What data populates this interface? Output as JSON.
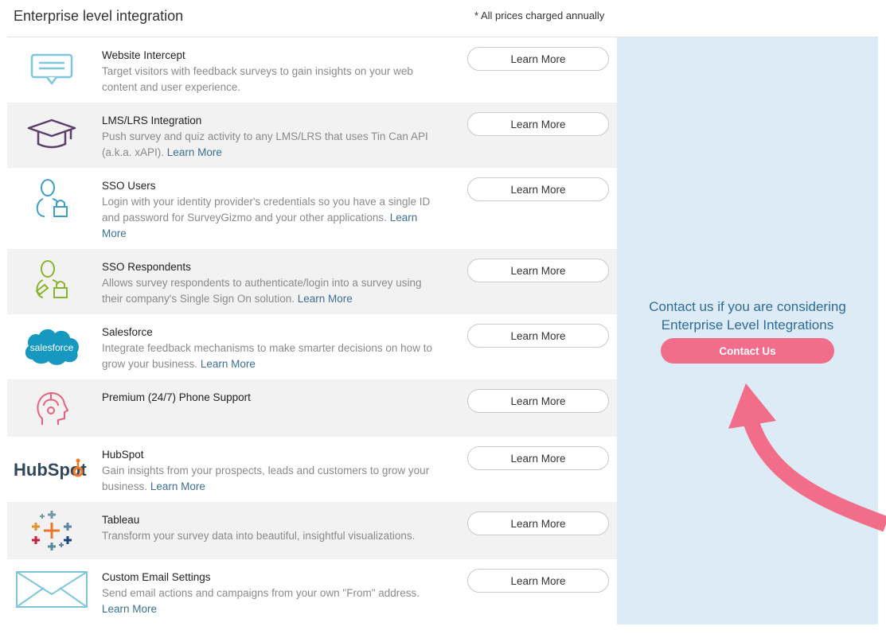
{
  "header": {
    "title": "Enterprise level integration",
    "note": "* All prices charged annually"
  },
  "integrations": [
    {
      "title": "Website Intercept",
      "desc": "Target visitors with feedback surveys to gain insights on your web content and user experience.",
      "link": "",
      "button": "Learn More",
      "icon": "chat-bubble-icon"
    },
    {
      "title": "LMS/LRS Integration",
      "desc": "Push survey and quiz activity to any LMS/LRS that uses Tin Can API (a.k.a. xAPI).",
      "link": "Learn More",
      "button": "Learn More",
      "icon": "graduation-cap-icon"
    },
    {
      "title": "SSO Users",
      "desc": "Login with your identity provider's credentials so you have a single ID and password for SurveyGizmo and your other applications.",
      "link": "Learn More",
      "button": "Learn More",
      "icon": "user-lock-icon"
    },
    {
      "title": "SSO Respondents",
      "desc": "Allows survey respondents to authenticate/login into a survey using their company's Single Sign On solution.",
      "link": "Learn More",
      "button": "Learn More",
      "icon": "respondent-lock-icon"
    },
    {
      "title": "Salesforce",
      "desc": "Integrate feedback mechanisms to make smarter decisions on how to grow your business.",
      "link": "Learn More",
      "button": "Learn More",
      "icon": "salesforce-logo",
      "logo_text": "salesforce"
    },
    {
      "title": "Premium (24/7) Phone Support",
      "desc": "",
      "link": "",
      "button": "Learn More",
      "icon": "headset-icon"
    },
    {
      "title": "HubSpot",
      "desc": "Gain insights from your prospects, leads and customers to grow your business.",
      "link": "Learn More",
      "button": "Learn More",
      "icon": "hubspot-logo",
      "logo_text": "HubSpot"
    },
    {
      "title": "Tableau",
      "desc": "Transform your survey data into beautiful, insightful visualizations.",
      "link": "",
      "button": "Learn More",
      "icon": "tableau-logo"
    },
    {
      "title": "Custom Email Settings",
      "desc": "Send email actions and campaigns from your own \"From\" address.",
      "link": "Learn More",
      "button": "Learn More",
      "icon": "envelope-icon"
    }
  ],
  "side": {
    "message_line1": "Contact us if you are considering",
    "message_line2": "Enterprise Level Integrations",
    "button": "Contact Us"
  },
  "colors": {
    "accent_pink": "#f26d8a",
    "link_blue": "#3b6f94",
    "side_bg": "#dcebf5"
  }
}
